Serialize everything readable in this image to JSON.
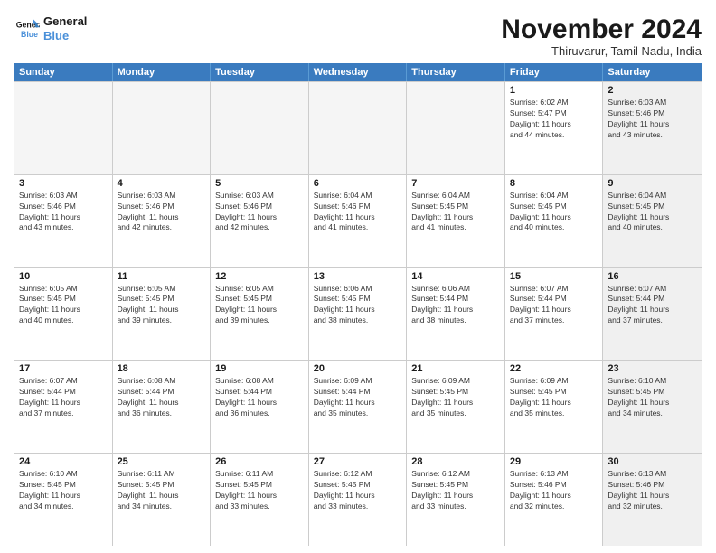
{
  "header": {
    "logo_line1": "General",
    "logo_line2": "Blue",
    "month": "November 2024",
    "location": "Thiruvarur, Tamil Nadu, India"
  },
  "weekdays": [
    "Sunday",
    "Monday",
    "Tuesday",
    "Wednesday",
    "Thursday",
    "Friday",
    "Saturday"
  ],
  "rows": [
    [
      {
        "day": "",
        "info": "",
        "shaded": true
      },
      {
        "day": "",
        "info": "",
        "shaded": true
      },
      {
        "day": "",
        "info": "",
        "shaded": true
      },
      {
        "day": "",
        "info": "",
        "shaded": true
      },
      {
        "day": "",
        "info": "",
        "shaded": true
      },
      {
        "day": "1",
        "info": "Sunrise: 6:02 AM\nSunset: 5:47 PM\nDaylight: 11 hours\nand 44 minutes.",
        "shaded": false
      },
      {
        "day": "2",
        "info": "Sunrise: 6:03 AM\nSunset: 5:46 PM\nDaylight: 11 hours\nand 43 minutes.",
        "shaded": true
      }
    ],
    [
      {
        "day": "3",
        "info": "Sunrise: 6:03 AM\nSunset: 5:46 PM\nDaylight: 11 hours\nand 43 minutes.",
        "shaded": false
      },
      {
        "day": "4",
        "info": "Sunrise: 6:03 AM\nSunset: 5:46 PM\nDaylight: 11 hours\nand 42 minutes.",
        "shaded": false
      },
      {
        "day": "5",
        "info": "Sunrise: 6:03 AM\nSunset: 5:46 PM\nDaylight: 11 hours\nand 42 minutes.",
        "shaded": false
      },
      {
        "day": "6",
        "info": "Sunrise: 6:04 AM\nSunset: 5:46 PM\nDaylight: 11 hours\nand 41 minutes.",
        "shaded": false
      },
      {
        "day": "7",
        "info": "Sunrise: 6:04 AM\nSunset: 5:45 PM\nDaylight: 11 hours\nand 41 minutes.",
        "shaded": false
      },
      {
        "day": "8",
        "info": "Sunrise: 6:04 AM\nSunset: 5:45 PM\nDaylight: 11 hours\nand 40 minutes.",
        "shaded": false
      },
      {
        "day": "9",
        "info": "Sunrise: 6:04 AM\nSunset: 5:45 PM\nDaylight: 11 hours\nand 40 minutes.",
        "shaded": true
      }
    ],
    [
      {
        "day": "10",
        "info": "Sunrise: 6:05 AM\nSunset: 5:45 PM\nDaylight: 11 hours\nand 40 minutes.",
        "shaded": false
      },
      {
        "day": "11",
        "info": "Sunrise: 6:05 AM\nSunset: 5:45 PM\nDaylight: 11 hours\nand 39 minutes.",
        "shaded": false
      },
      {
        "day": "12",
        "info": "Sunrise: 6:05 AM\nSunset: 5:45 PM\nDaylight: 11 hours\nand 39 minutes.",
        "shaded": false
      },
      {
        "day": "13",
        "info": "Sunrise: 6:06 AM\nSunset: 5:45 PM\nDaylight: 11 hours\nand 38 minutes.",
        "shaded": false
      },
      {
        "day": "14",
        "info": "Sunrise: 6:06 AM\nSunset: 5:44 PM\nDaylight: 11 hours\nand 38 minutes.",
        "shaded": false
      },
      {
        "day": "15",
        "info": "Sunrise: 6:07 AM\nSunset: 5:44 PM\nDaylight: 11 hours\nand 37 minutes.",
        "shaded": false
      },
      {
        "day": "16",
        "info": "Sunrise: 6:07 AM\nSunset: 5:44 PM\nDaylight: 11 hours\nand 37 minutes.",
        "shaded": true
      }
    ],
    [
      {
        "day": "17",
        "info": "Sunrise: 6:07 AM\nSunset: 5:44 PM\nDaylight: 11 hours\nand 37 minutes.",
        "shaded": false
      },
      {
        "day": "18",
        "info": "Sunrise: 6:08 AM\nSunset: 5:44 PM\nDaylight: 11 hours\nand 36 minutes.",
        "shaded": false
      },
      {
        "day": "19",
        "info": "Sunrise: 6:08 AM\nSunset: 5:44 PM\nDaylight: 11 hours\nand 36 minutes.",
        "shaded": false
      },
      {
        "day": "20",
        "info": "Sunrise: 6:09 AM\nSunset: 5:44 PM\nDaylight: 11 hours\nand 35 minutes.",
        "shaded": false
      },
      {
        "day": "21",
        "info": "Sunrise: 6:09 AM\nSunset: 5:45 PM\nDaylight: 11 hours\nand 35 minutes.",
        "shaded": false
      },
      {
        "day": "22",
        "info": "Sunrise: 6:09 AM\nSunset: 5:45 PM\nDaylight: 11 hours\nand 35 minutes.",
        "shaded": false
      },
      {
        "day": "23",
        "info": "Sunrise: 6:10 AM\nSunset: 5:45 PM\nDaylight: 11 hours\nand 34 minutes.",
        "shaded": true
      }
    ],
    [
      {
        "day": "24",
        "info": "Sunrise: 6:10 AM\nSunset: 5:45 PM\nDaylight: 11 hours\nand 34 minutes.",
        "shaded": false
      },
      {
        "day": "25",
        "info": "Sunrise: 6:11 AM\nSunset: 5:45 PM\nDaylight: 11 hours\nand 34 minutes.",
        "shaded": false
      },
      {
        "day": "26",
        "info": "Sunrise: 6:11 AM\nSunset: 5:45 PM\nDaylight: 11 hours\nand 33 minutes.",
        "shaded": false
      },
      {
        "day": "27",
        "info": "Sunrise: 6:12 AM\nSunset: 5:45 PM\nDaylight: 11 hours\nand 33 minutes.",
        "shaded": false
      },
      {
        "day": "28",
        "info": "Sunrise: 6:12 AM\nSunset: 5:45 PM\nDaylight: 11 hours\nand 33 minutes.",
        "shaded": false
      },
      {
        "day": "29",
        "info": "Sunrise: 6:13 AM\nSunset: 5:46 PM\nDaylight: 11 hours\nand 32 minutes.",
        "shaded": false
      },
      {
        "day": "30",
        "info": "Sunrise: 6:13 AM\nSunset: 5:46 PM\nDaylight: 11 hours\nand 32 minutes.",
        "shaded": true
      }
    ]
  ]
}
